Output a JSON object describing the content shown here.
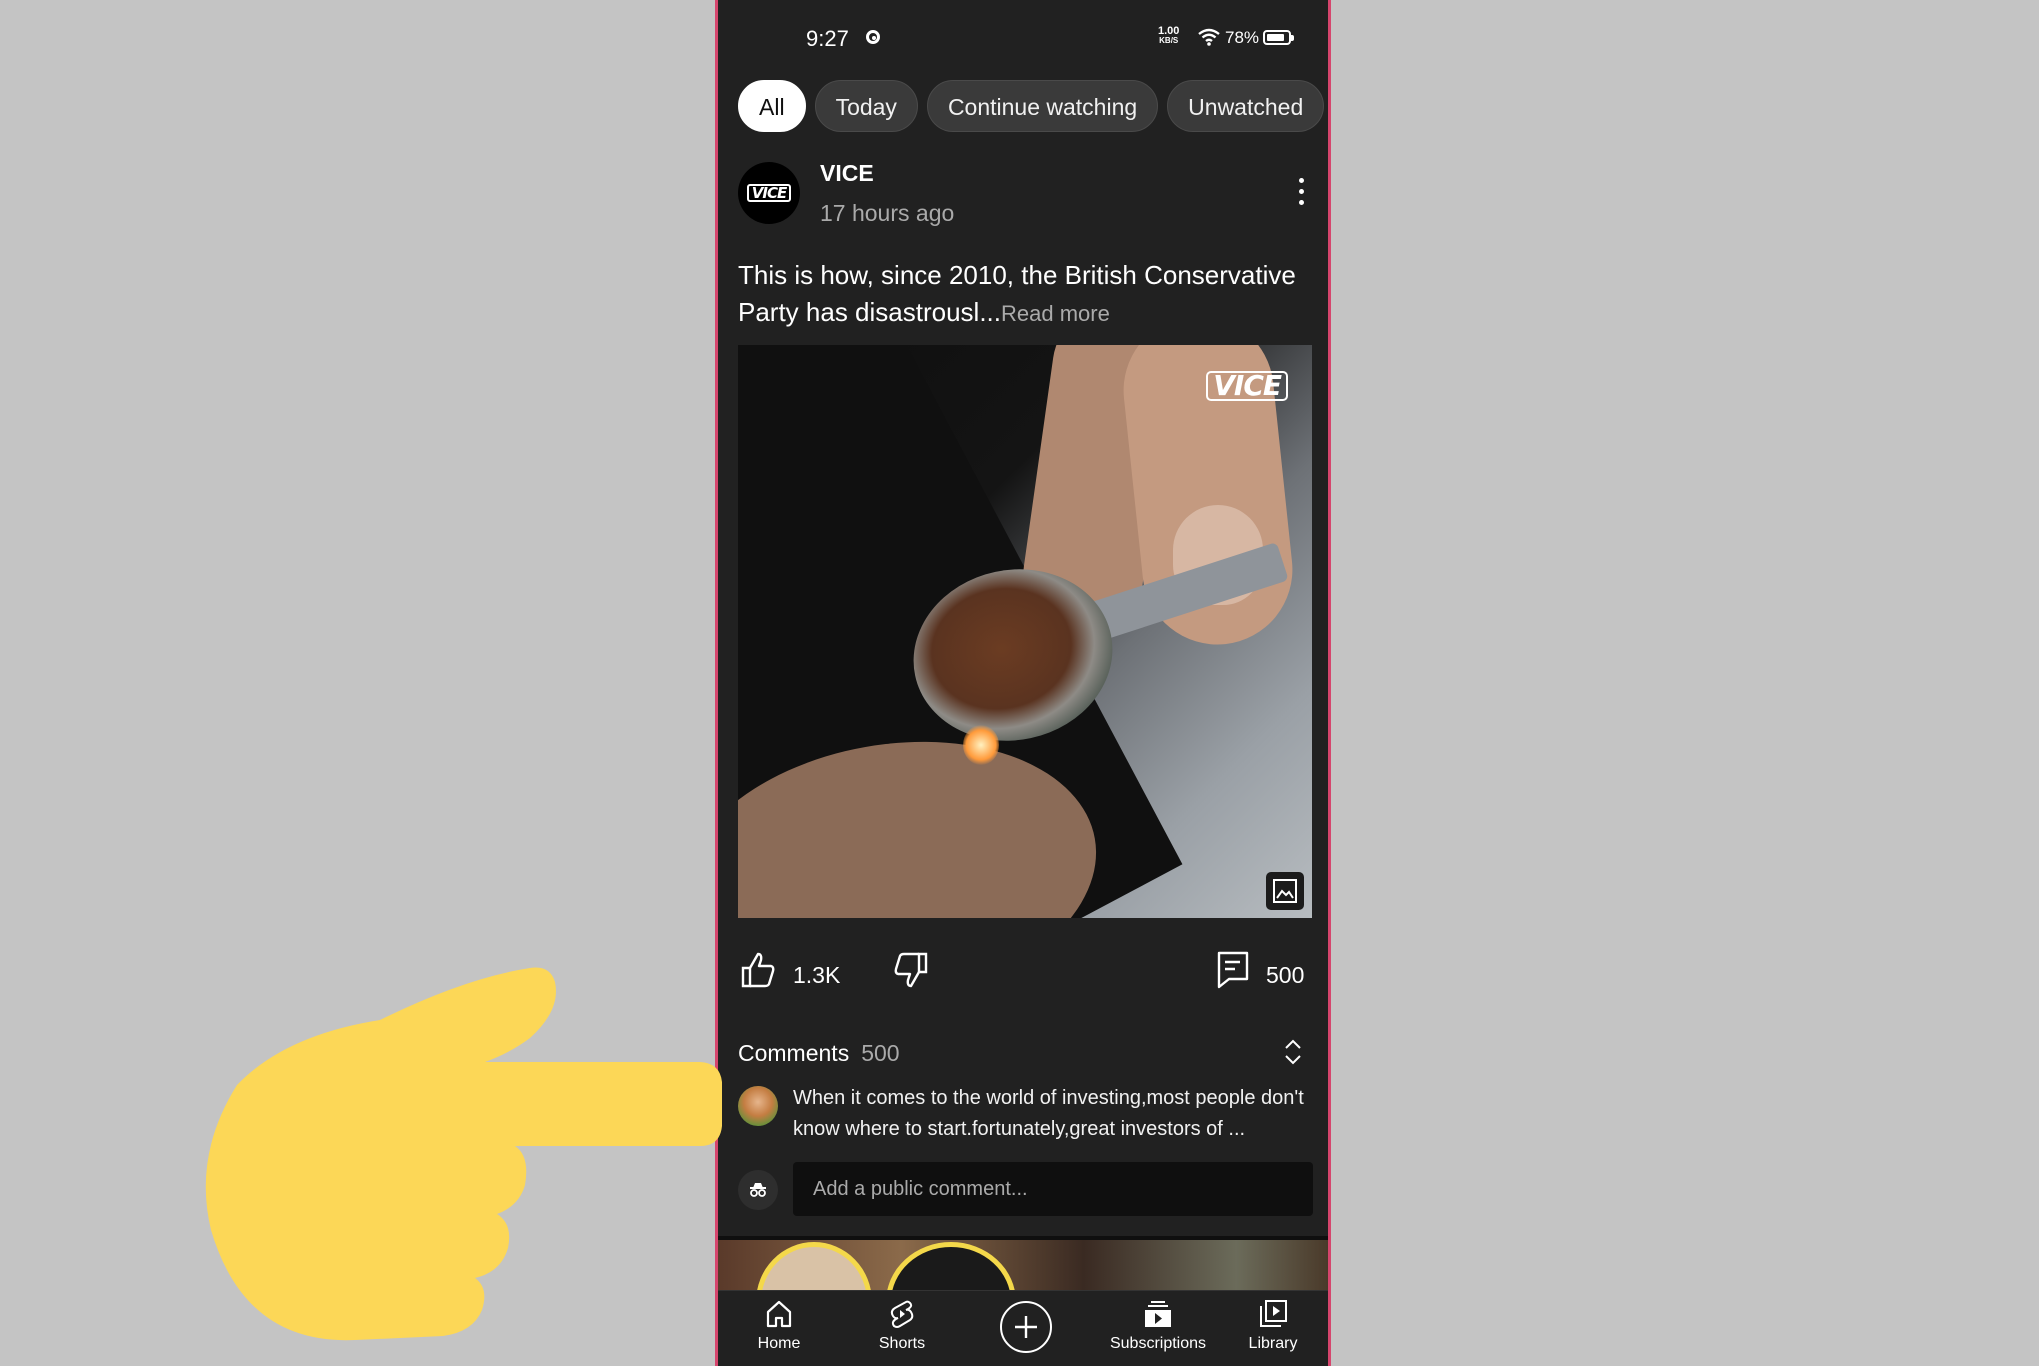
{
  "status_bar": {
    "time": "9:27",
    "speed_value": "1.00",
    "speed_unit": "KB/S",
    "battery": "78%"
  },
  "chips": [
    "All",
    "Today",
    "Continue watching",
    "Unwatched"
  ],
  "post": {
    "channel_name": "VICE",
    "avatar_logo": "VICE",
    "age": "17 hours ago",
    "text": "This is how, since 2010, the British Conservative Party has disastrousl...",
    "read_more": "Read more",
    "image_watermark": "VICE",
    "likes": "1.3K",
    "comment_count": "500"
  },
  "comments": {
    "title": "Comments",
    "count": "500",
    "top_comment": "When it comes to the world of investing,most people don't know where to start.fortunately,great investors of ...",
    "input_placeholder": "Add a public comment..."
  },
  "nav": {
    "home": "Home",
    "shorts": "Shorts",
    "subscriptions": "Subscriptions",
    "library": "Library"
  },
  "colors": {
    "background": "#c4c4c4",
    "app_background": "#212121",
    "frame_border": "#d6456d",
    "pointer_hand": "#fcd757"
  }
}
